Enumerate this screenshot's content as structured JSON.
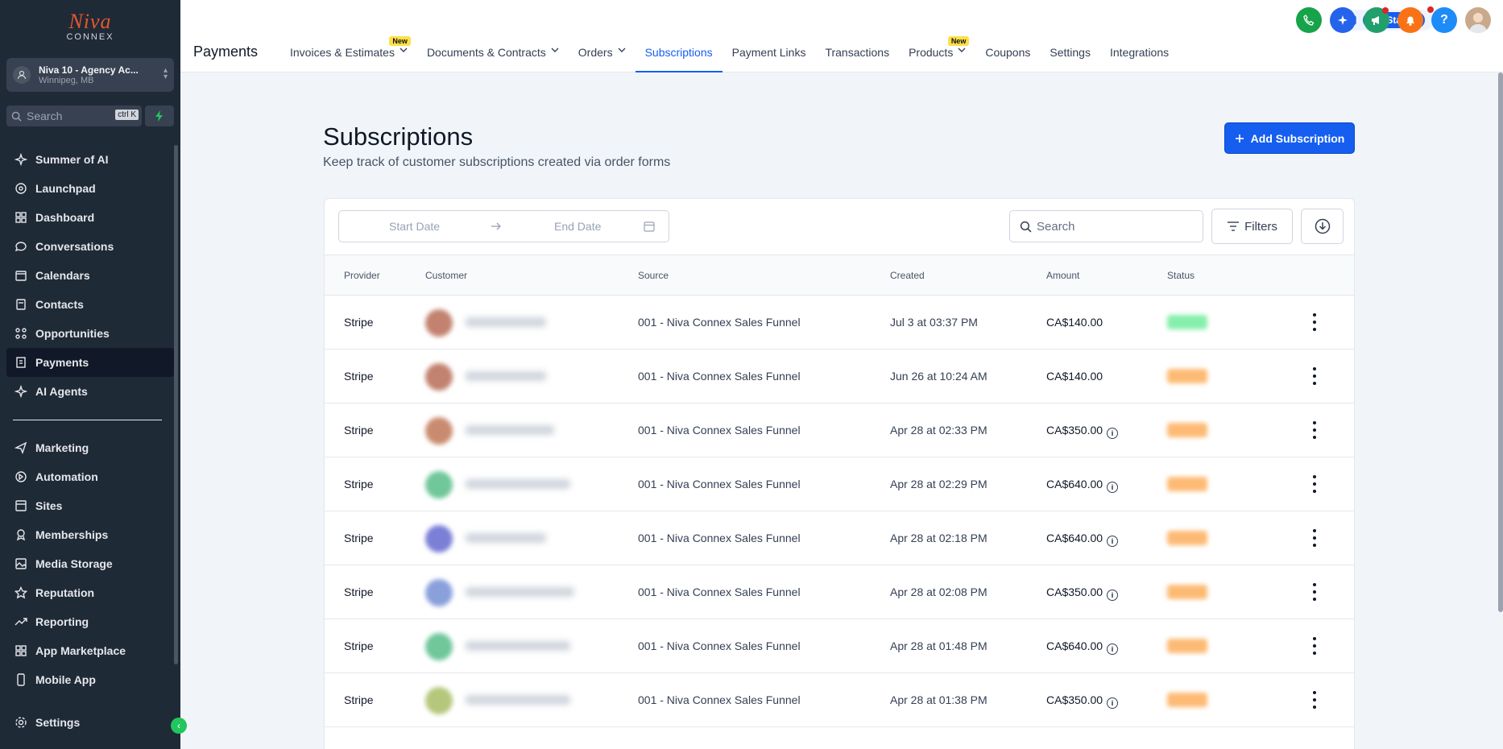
{
  "brand": {
    "logo_top": "Niva",
    "logo_bottom": "CONNEX"
  },
  "account": {
    "name": "Niva 10 - Agency Ac...",
    "location": "Winnipeg, MB"
  },
  "sidebar_search": {
    "placeholder": "Search",
    "shortcut": "ctrl K"
  },
  "sidebar": {
    "items_top": [
      {
        "label": "Summer of AI",
        "icon": "sparkles-icon"
      },
      {
        "label": "Launchpad",
        "icon": "rocket-icon"
      },
      {
        "label": "Dashboard",
        "icon": "grid-icon"
      },
      {
        "label": "Conversations",
        "icon": "chat-icon"
      },
      {
        "label": "Calendars",
        "icon": "calendar-icon"
      },
      {
        "label": "Contacts",
        "icon": "contacts-icon"
      },
      {
        "label": "Opportunities",
        "icon": "opportunities-icon"
      },
      {
        "label": "Payments",
        "icon": "receipt-icon",
        "active": true
      },
      {
        "label": "AI Agents",
        "icon": "sparkles-icon"
      }
    ],
    "items_bottom": [
      {
        "label": "Marketing",
        "icon": "send-icon"
      },
      {
        "label": "Automation",
        "icon": "automation-icon"
      },
      {
        "label": "Sites",
        "icon": "sites-icon"
      },
      {
        "label": "Memberships",
        "icon": "membership-icon"
      },
      {
        "label": "Media Storage",
        "icon": "image-icon"
      },
      {
        "label": "Reputation",
        "icon": "star-icon"
      },
      {
        "label": "Reporting",
        "icon": "trend-icon"
      },
      {
        "label": "App Marketplace",
        "icon": "apps-icon"
      },
      {
        "label": "Mobile App",
        "icon": "phone-icon"
      }
    ],
    "settings_label": "Settings"
  },
  "header": {
    "page_title": "Payments",
    "tabs": [
      {
        "label": "Invoices & Estimates",
        "dropdown": true,
        "badge": "New"
      },
      {
        "label": "Documents & Contracts",
        "dropdown": true
      },
      {
        "label": "Orders",
        "dropdown": true
      },
      {
        "label": "Subscriptions",
        "active": true
      },
      {
        "label": "Payment Links"
      },
      {
        "label": "Transactions"
      },
      {
        "label": "Products",
        "dropdown": true,
        "badge": "New"
      },
      {
        "label": "Coupons"
      },
      {
        "label": "Settings"
      },
      {
        "label": "Integrations"
      }
    ],
    "get_started": "Get Started"
  },
  "main": {
    "title": "Subscriptions",
    "subtitle": "Keep track of customer subscriptions created via order forms",
    "add_button": "Add Subscription",
    "start_date_placeholder": "Start Date",
    "end_date_placeholder": "End Date",
    "search_placeholder": "Search",
    "filters_label": "Filters"
  },
  "table": {
    "columns": [
      "Provider",
      "Customer",
      "Source",
      "Created",
      "Amount",
      "Status"
    ],
    "rows": [
      {
        "provider": "Stripe",
        "source": "001 - Niva Connex Sales Funnel",
        "created": "Jul 3 at 03:37 PM",
        "amount": "CA$140.00",
        "info": false,
        "avatar_color": "#c2826f",
        "status_color": "#86efac"
      },
      {
        "provider": "Stripe",
        "source": "001 - Niva Connex Sales Funnel",
        "created": "Jun 26 at 10:24 AM",
        "amount": "CA$140.00",
        "info": false,
        "avatar_color": "#c2826f",
        "status_color": "#fdba74"
      },
      {
        "provider": "Stripe",
        "source": "001 - Niva Connex Sales Funnel",
        "created": "Apr 28 at 02:33 PM",
        "amount": "CA$350.00",
        "info": true,
        "avatar_color": "#c98b6f",
        "status_color": "#fdba74"
      },
      {
        "provider": "Stripe",
        "source": "001 - Niva Connex Sales Funnel",
        "created": "Apr 28 at 02:29 PM",
        "amount": "CA$640.00",
        "info": true,
        "avatar_color": "#6fc79a",
        "status_color": "#fdba74"
      },
      {
        "provider": "Stripe",
        "source": "001 - Niva Connex Sales Funnel",
        "created": "Apr 28 at 02:18 PM",
        "amount": "CA$640.00",
        "info": true,
        "avatar_color": "#7b7fd6",
        "status_color": "#fdba74"
      },
      {
        "provider": "Stripe",
        "source": "001 - Niva Connex Sales Funnel",
        "created": "Apr 28 at 02:08 PM",
        "amount": "CA$350.00",
        "info": true,
        "avatar_color": "#8aa0db",
        "status_color": "#fdba74"
      },
      {
        "provider": "Stripe",
        "source": "001 - Niva Connex Sales Funnel",
        "created": "Apr 28 at 01:48 PM",
        "amount": "CA$640.00",
        "info": true,
        "avatar_color": "#6fc79a",
        "status_color": "#fdba74"
      },
      {
        "provider": "Stripe",
        "source": "001 - Niva Connex Sales Funnel",
        "created": "Apr 28 at 01:38 PM",
        "amount": "CA$350.00",
        "info": true,
        "avatar_color": "#b5c77a",
        "status_color": "#fdba74"
      }
    ]
  },
  "colors": {
    "accent": "#155eef",
    "sidebar_bg": "#1f2a37",
    "call": "#16a34a",
    "ai": "#2563eb",
    "announce": "#22a06b",
    "notify": "#f97316",
    "help": "#1d8cf8"
  }
}
